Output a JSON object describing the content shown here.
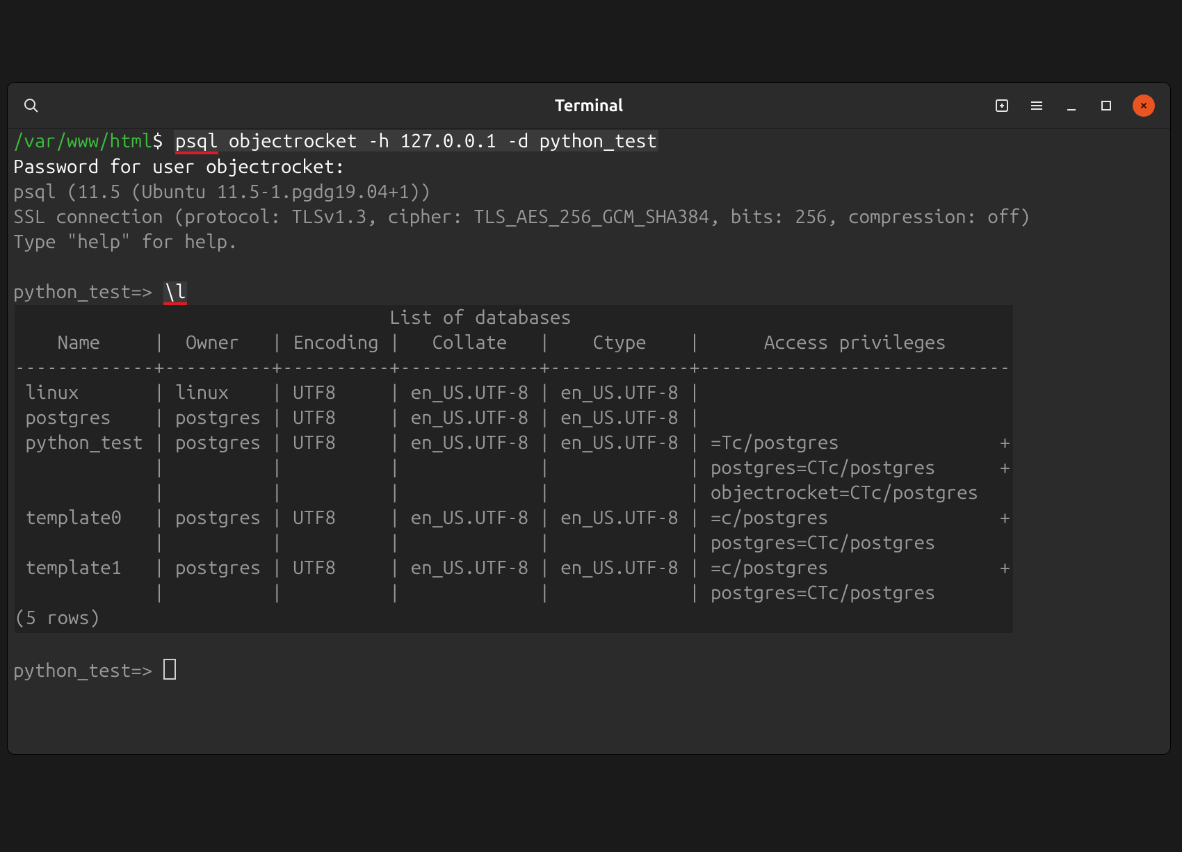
{
  "window": {
    "title": "Terminal"
  },
  "shell": {
    "cwd": "/var/www/html",
    "prompt_symbol": "$",
    "command_psql": "psql",
    "command_rest": " objectrocket -h 127.0.0.1 -d python_test",
    "password_line": "Password for user objectrocket:",
    "psql_version": "psql (11.5 (Ubuntu 11.5-1.pgdg19.04+1))",
    "ssl_line": "SSL connection (protocol: TLSv1.3, cipher: TLS_AES_256_GCM_SHA384, bits: 256, compression: off)",
    "help_line": "Type \"help\" for help.",
    "db_prompt": "python_test=>",
    "meta_cmd": "\\l",
    "list_title": "                                   List of databases",
    "header": "    Name     |  Owner   | Encoding |   Collate   |    Ctype    |      Access privileges      ",
    "sep": "-------------+----------+----------+-------------+-------------+-----------------------------",
    "rows": [
      " linux       | linux    | UTF8     | en_US.UTF-8 | en_US.UTF-8 | ",
      " postgres    | postgres | UTF8     | en_US.UTF-8 | en_US.UTF-8 | ",
      " python_test | postgres | UTF8     | en_US.UTF-8 | en_US.UTF-8 | =Tc/postgres               +",
      "             |          |          |             |             | postgres=CTc/postgres      +",
      "             |          |          |             |             | objectrocket=CTc/postgres",
      " template0   | postgres | UTF8     | en_US.UTF-8 | en_US.UTF-8 | =c/postgres                +",
      "             |          |          |             |             | postgres=CTc/postgres",
      " template1   | postgres | UTF8     | en_US.UTF-8 | en_US.UTF-8 | =c/postgres                +",
      "             |          |          |             |             | postgres=CTc/postgres"
    ],
    "row_count": "(5 rows)"
  }
}
